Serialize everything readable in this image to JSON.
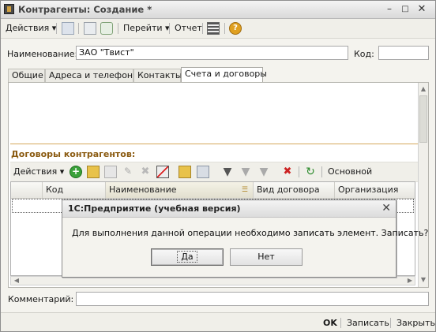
{
  "window": {
    "title": "Контрагенты: Создание *",
    "controls": [
      "minimize-icon",
      "maximize-icon",
      "close-icon"
    ]
  },
  "toolbar": {
    "actions_label": "Действия",
    "goto_label": "Перейти",
    "report_label": "Отчет"
  },
  "form": {
    "name_label": "Наименование:",
    "name_value": "ЗАО \"Твист\"",
    "code_label": "Код:",
    "code_value": "",
    "comment_label": "Комментарий:",
    "comment_value": ""
  },
  "tabs": [
    {
      "label": "Общие"
    },
    {
      "label": "Адреса и телефоны"
    },
    {
      "label": "Контакты"
    },
    {
      "label": "Счета и договоры",
      "active": true
    }
  ],
  "contracts": {
    "title": "Договоры контрагентов:",
    "actions_label": "Действия",
    "basic_label": "Основной",
    "columns": [
      "Код",
      "Наименование",
      "Вид договора",
      "Организация"
    ]
  },
  "bottom": {
    "ok_label": "OK",
    "save_label": "Записать",
    "close_label": "Закрыть"
  },
  "dialog": {
    "title": "1С:Предприятие (учебная версия)",
    "message": "Для выполнения данной операции необходимо записать элемент. Записать?",
    "yes_label": "Да",
    "no_label": "Нет"
  },
  "colors": {
    "section_title": "#8a5a10",
    "section_line": "#d5a85a",
    "help_icon": "#e0a020",
    "add_icon": "#3aa13a"
  }
}
